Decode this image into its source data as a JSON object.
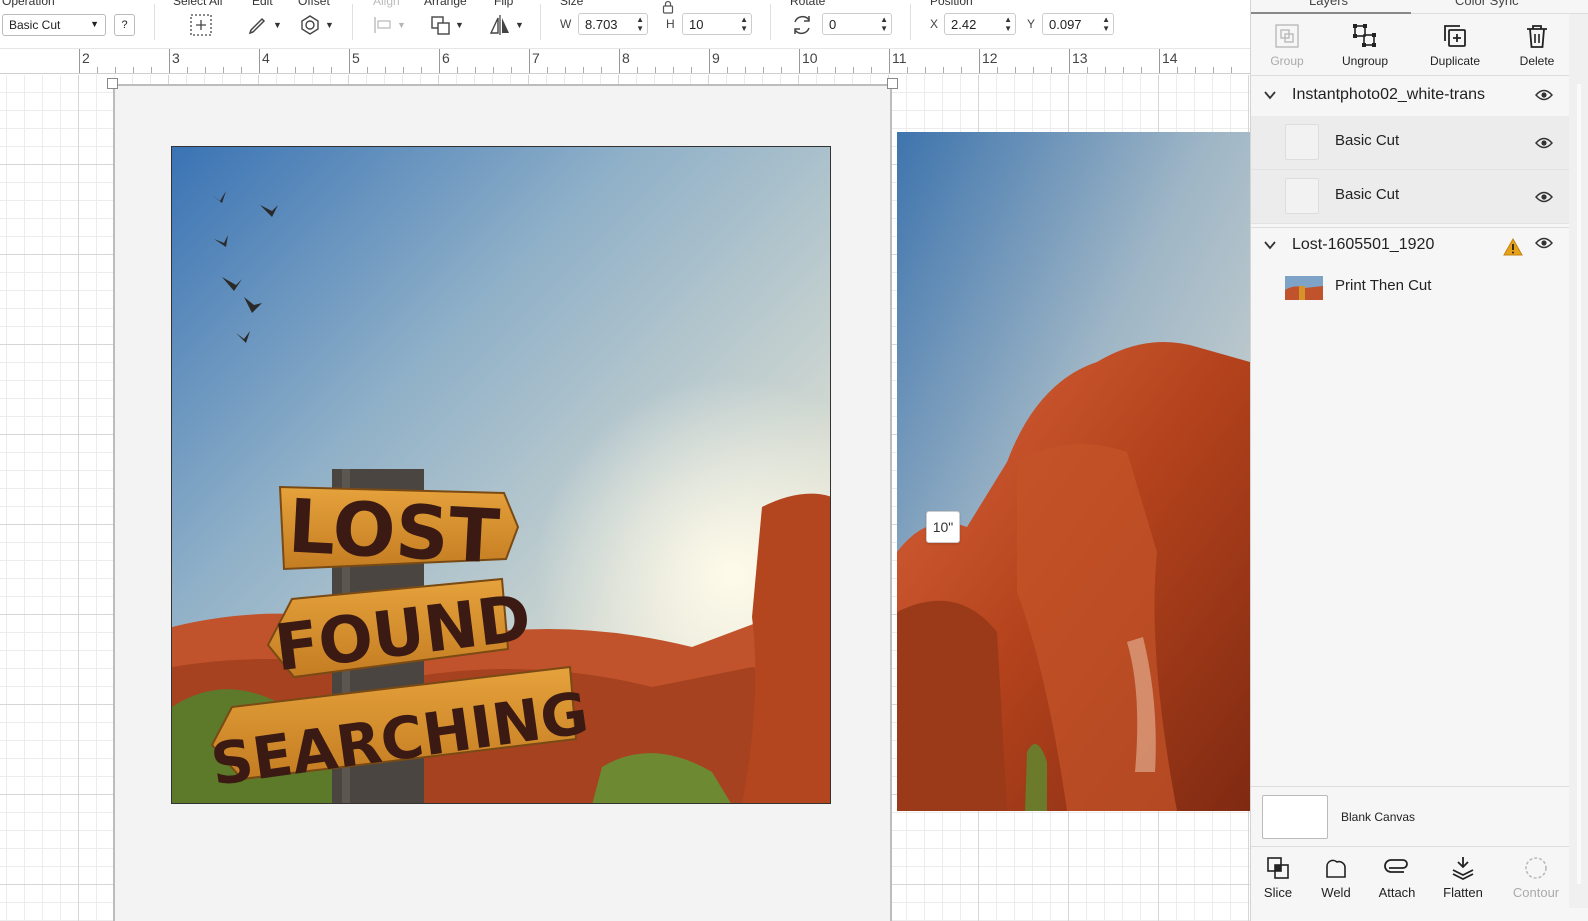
{
  "toolbar": {
    "operation_label": "Operation",
    "operation_value": "Basic Cut",
    "help_label": "?",
    "select_all_label": "Select All",
    "edit_label": "Edit",
    "offset_label": "Offset",
    "align_label": "Align",
    "arrange_label": "Arrange",
    "flip_label": "Flip",
    "size_label": "Size",
    "w_label": "W",
    "w_value": "8.703",
    "h_label": "H",
    "h_value": "10",
    "rotate_label": "Rotate",
    "rotate_value": "0",
    "position_label": "Position",
    "x_label": "X",
    "x_value": "2.42",
    "y_label": "Y",
    "y_value": "0.097"
  },
  "ruler": {
    "labels": [
      "2",
      "3",
      "4",
      "5",
      "6",
      "7",
      "8",
      "9",
      "10",
      "11",
      "12",
      "13",
      "14"
    ]
  },
  "canvas": {
    "dimension_tag": "10\"",
    "sign_words": [
      "LOST",
      "FOUND",
      "SEARCHING"
    ]
  },
  "panel": {
    "tabs": [
      "Layers",
      "Color Sync"
    ],
    "actions": [
      {
        "label": "Group",
        "icon": "group-icon",
        "enabled": false
      },
      {
        "label": "Ungroup",
        "icon": "ungroup-icon",
        "enabled": true
      },
      {
        "label": "Duplicate",
        "icon": "duplicate-icon",
        "enabled": true
      },
      {
        "label": "Delete",
        "icon": "trash-icon",
        "enabled": true
      }
    ],
    "groups": [
      {
        "name": "Instantphoto02_white-trans",
        "children": [
          {
            "name": "Basic Cut"
          },
          {
            "name": "Basic Cut"
          }
        ]
      },
      {
        "name": "Lost-1605501_1920",
        "warning": true,
        "children": [
          {
            "name": "Print Then Cut"
          }
        ]
      }
    ],
    "blank_canvas_label": "Blank Canvas",
    "bottom_actions": [
      {
        "label": "Slice",
        "icon": "slice-icon",
        "enabled": true
      },
      {
        "label": "Weld",
        "icon": "weld-icon",
        "enabled": true
      },
      {
        "label": "Attach",
        "icon": "attach-icon",
        "enabled": true
      },
      {
        "label": "Flatten",
        "icon": "flatten-icon",
        "enabled": true
      },
      {
        "label": "Contour",
        "icon": "contour-icon",
        "enabled": false
      }
    ]
  },
  "colors": {
    "accent_warning": "#e8a21a",
    "sign_wood": "#d9912a",
    "rock": "#b8461f",
    "sky": "#4a7fb8"
  }
}
